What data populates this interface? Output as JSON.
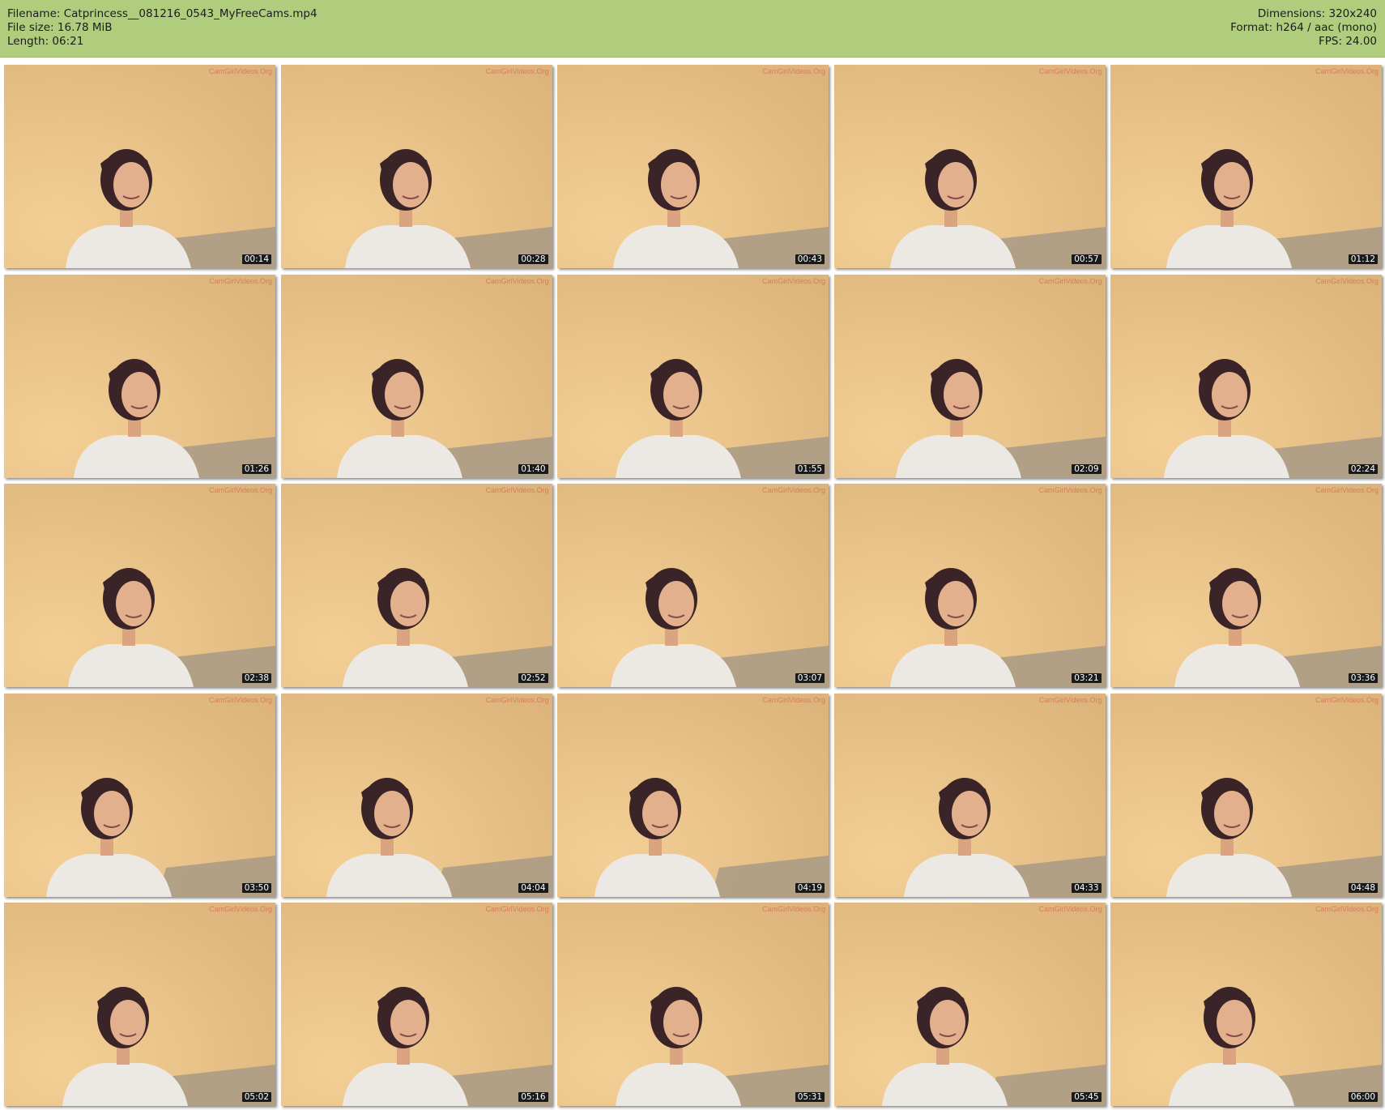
{
  "header": {
    "background": "#b0cd7e",
    "filename_line": "Filename: Catprincess__081216_0543_MyFreeCams.mp4",
    "filesize_line": "File size: 16.78 MiB",
    "length_line": "Length: 06:21",
    "dimensions_line": "Dimensions: 320x240",
    "format_line": "Format: h264 / aac (mono)",
    "fps_line": "FPS: 24.00"
  },
  "thumbnails": {
    "watermark": "CamGirlVideos.Org",
    "timestamps": [
      "00:14",
      "00:28",
      "00:43",
      "00:57",
      "01:12",
      "01:26",
      "01:40",
      "01:55",
      "02:09",
      "02:24",
      "02:38",
      "02:52",
      "03:07",
      "03:21",
      "03:36",
      "03:50",
      "04:04",
      "04:19",
      "04:33",
      "04:48",
      "05:02",
      "05:16",
      "05:31",
      "05:45",
      "06:00"
    ]
  }
}
